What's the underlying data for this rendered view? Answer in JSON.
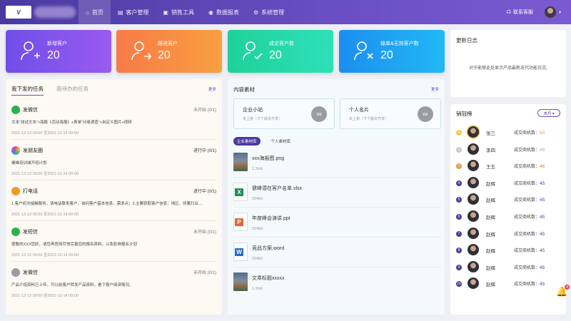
{
  "brand": {
    "logo": "V"
  },
  "nav": [
    {
      "label": "首页",
      "icon": "home-icon",
      "glyph": "⌂"
    },
    {
      "label": "客户管理",
      "icon": "document-icon",
      "glyph": "▤"
    },
    {
      "label": "销售工具",
      "icon": "briefcase-icon",
      "glyph": "▣"
    },
    {
      "label": "数据报表",
      "icon": "database-icon",
      "glyph": "◉"
    },
    {
      "label": "系统管理",
      "icon": "gear-icon",
      "glyph": "⚙"
    }
  ],
  "header": {
    "support": "联系客服"
  },
  "stats": [
    {
      "label": "新增客户",
      "value": "20",
      "icon": "user-add-icon"
    },
    {
      "label": "跟进客户",
      "value": "20",
      "icon": "user-follow-icon"
    },
    {
      "label": "成交客户数",
      "value": "20",
      "icon": "user-check-icon"
    },
    {
      "label": "输单&无效客户数",
      "value": "20",
      "icon": "user-remove-icon"
    }
  ],
  "update_log": {
    "title": "更新日志",
    "text": "对于能够此处显示产品最新迭代功能日志;"
  },
  "tasks": {
    "tab_sent": "我下发的任务",
    "tab_todo": "我待办的任务",
    "more": "更多",
    "items": [
      {
        "name": "发微信",
        "status": "未开始 (0/1)",
        "desc": "文本“测试文本”+海报《活动海报》+表单“问卷调查”+自定义图片+视频",
        "time": "2021-12-12 09:00 至2021-12-14 09:00",
        "icon": "wechat-icon",
        "color": "#2bb24c"
      },
      {
        "name": "发朋友圈",
        "status": "进行中 (0/1)",
        "desc": "健峰培训城开班计划",
        "time": "2021-12-12 09:00 至2021-12-14 09:00",
        "icon": "moments-icon",
        "color": "#e84c8a"
      },
      {
        "name": "打电话",
        "status": "进行中 (0/1)",
        "desc": "1.客户初次接触服务，请电话联系客户，询问客户基本信息，需求点；2.主要获取客户信息：地区、所属行业...",
        "time": "2021-12-12 09:00 至2021-12-14 09:00",
        "icon": "phone-icon",
        "color": "#f09a2a"
      },
      {
        "name": "发短信",
        "status": "未开始 (0/1)",
        "desc": "尊敬的XXX您好，请您再官网尽快完善您的报名资料，以免影响报名计划",
        "time": "2021-12-12 09:00 至2021-12-14 09:00",
        "icon": "sms-icon",
        "color": "#2bb24c"
      },
      {
        "name": "发微信",
        "status": "未开始 (0/1)",
        "desc": "产品介绍资料已上传，可以给客户转发产品资料，看下客户阅读情况。",
        "time": "2021-12-12 09:00 至2021-12-14 09:00",
        "icon": "wechat-grey-icon",
        "color": "#9a9ca4"
      }
    ]
  },
  "materials": {
    "title": "内容素材",
    "more": "更多",
    "cards": [
      {
        "name": "企业小站",
        "sub": "未上架（下个版本开发）"
      },
      {
        "name": "个人名片",
        "sub": "未上架（下个版本开发）"
      }
    ],
    "tab_company": "企业素材库",
    "tab_personal": "个人素材库",
    "files": [
      {
        "name": "xxx海报图.png",
        "size": "1.2mb",
        "type": "image"
      },
      {
        "name": "健峰潜在客户名单.xlsx",
        "size": "254kb",
        "type": "excel",
        "badge": "X",
        "color": "#1f8f4a"
      },
      {
        "name": "年度峰会演讲.ppt",
        "size": "254kb",
        "type": "ppt",
        "badge": "P",
        "color": "#e0663a"
      },
      {
        "name": "竞品方案.word",
        "size": "254kb",
        "type": "word",
        "badge": "W",
        "color": "#2b6cc4"
      },
      {
        "name": "文章标题xxxxx",
        "size": "1.2mb",
        "type": "image"
      }
    ]
  },
  "ranking": {
    "title": "销冠榜",
    "period": "本月 ▾",
    "deal_label": "成交商机数：",
    "rows": [
      {
        "rank": "1",
        "name": "张三",
        "deals": "50",
        "medal": "#f5c94a",
        "dcolor": "#e0a020"
      },
      {
        "rank": "2",
        "name": "李四",
        "deals": "48",
        "medal": "#c8c8cc",
        "dcolor": "#aaaaaa"
      },
      {
        "rank": "3",
        "name": "王五",
        "deals": "46",
        "medal": "#e09a4a",
        "dcolor": "#d08030"
      },
      {
        "rank": "4",
        "name": "赵辉",
        "deals": "45",
        "medal": "#4a3aa0",
        "dcolor": "#4a3aa0"
      },
      {
        "rank": "5",
        "name": "赵辉",
        "deals": "45",
        "medal": "#4a3aa0",
        "dcolor": "#4a3aa0"
      },
      {
        "rank": "6",
        "name": "赵辉",
        "deals": "45",
        "medal": "#4a3aa0",
        "dcolor": "#4a3aa0"
      },
      {
        "rank": "7",
        "name": "赵辉",
        "deals": "45",
        "medal": "#4a3aa0",
        "dcolor": "#4a3aa0"
      },
      {
        "rank": "8",
        "name": "赵辉",
        "deals": "45",
        "medal": "#4a3aa0",
        "dcolor": "#4a3aa0"
      },
      {
        "rank": "9",
        "name": "赵辉",
        "deals": "45",
        "medal": "#4a3aa0",
        "dcolor": "#4a3aa0"
      },
      {
        "rank": "10",
        "name": "赵辉",
        "deals": "45",
        "medal": "#4a3aa0",
        "dcolor": "#4a3aa0"
      }
    ]
  },
  "notifications": {
    "count": "4"
  }
}
